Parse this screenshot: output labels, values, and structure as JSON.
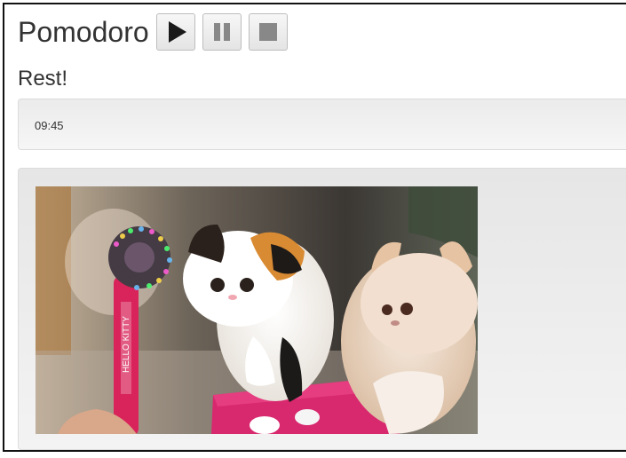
{
  "app": {
    "title": "Pomodoro"
  },
  "controls": {
    "play_icon": "play-icon",
    "pause_icon": "pause-icon",
    "stop_icon": "stop-icon"
  },
  "status": {
    "text": "Rest!"
  },
  "timer": {
    "value": "09:45"
  },
  "media": {
    "image_subject": "two cats looking at a spinning light-up fan toy",
    "toy_text": "HELLO KITTY"
  },
  "colors": {
    "text": "#333333",
    "panel": "#eeeeee",
    "toy_pink": "#d8245a"
  }
}
